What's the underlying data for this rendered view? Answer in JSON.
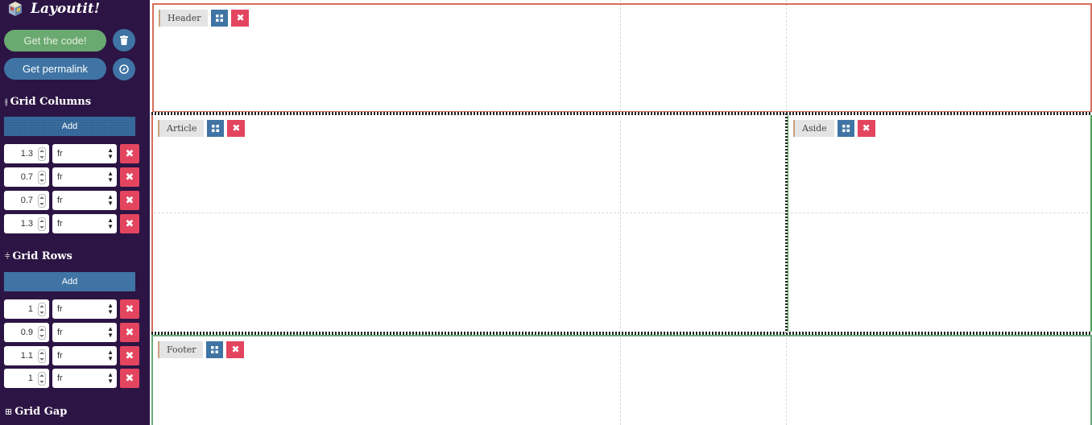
{
  "app": {
    "title": "Layoutit!"
  },
  "actions": {
    "get_code": "Get the code!",
    "get_permalink": "Get permalink"
  },
  "grid_columns": {
    "title": "Grid Columns",
    "add_label": "Add",
    "tracks": [
      {
        "value": "1.3",
        "unit": "fr"
      },
      {
        "value": "0.7",
        "unit": "fr"
      },
      {
        "value": "0.7",
        "unit": "fr"
      },
      {
        "value": "1.3",
        "unit": "fr"
      }
    ]
  },
  "grid_rows": {
    "title": "Grid Rows",
    "add_label": "Add",
    "tracks": [
      {
        "value": "1",
        "unit": "fr"
      },
      {
        "value": "0.9",
        "unit": "fr"
      },
      {
        "value": "1.1",
        "unit": "fr"
      },
      {
        "value": "1",
        "unit": "fr"
      }
    ]
  },
  "grid_gap": {
    "title": "Grid Gap"
  },
  "areas": [
    {
      "name": "Header"
    },
    {
      "name": "Article"
    },
    {
      "name": "Aside"
    },
    {
      "name": "Footer"
    }
  ],
  "colors": {
    "sidebar_bg": "#2c1544",
    "accent_blue": "#3f74a4",
    "accent_green": "#6aa970",
    "delete_red": "#e3455f",
    "area_orange": "#d96d5a",
    "area_green": "#4aa356"
  },
  "icons": {
    "logo": "cube-logo-icon",
    "trash": "trash-icon",
    "compass": "compass-icon",
    "columns_section": "columns-icon",
    "rows_section": "rows-icon",
    "gap_section": "gap-grid-icon",
    "select_arrow": "select-arrows-icon",
    "delete": "close-icon",
    "area_grid": "grid-icon"
  }
}
